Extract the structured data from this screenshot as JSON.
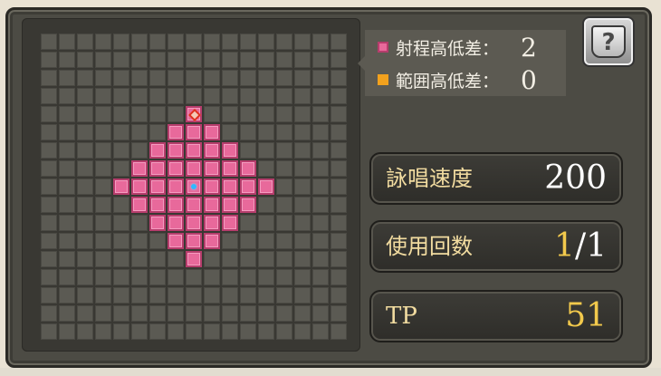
{
  "legend": {
    "range_height": {
      "label": "射程高低差：",
      "value": "2",
      "color": "#e8699b"
    },
    "area_height": {
      "label": "範囲高低差：",
      "value": "0",
      "color": "#f2a11d"
    }
  },
  "help_button": {
    "icon": "help-book-icon",
    "glyph": "?"
  },
  "stats": {
    "cast_speed": {
      "label": "詠唱速度",
      "value": "200"
    },
    "use_count": {
      "label": "使用回数",
      "current": "1",
      "separator": "/",
      "max": "1"
    },
    "tp": {
      "label": "TP",
      "value": "51"
    }
  },
  "grid": {
    "size": 17,
    "range_radius": 4,
    "center": [
      8,
      8
    ],
    "marker": [
      8,
      4
    ],
    "colors": {
      "empty": "#5b5a53",
      "range": "#e8699b",
      "center": "#2fb8ff",
      "marker": "#e03020"
    }
  }
}
